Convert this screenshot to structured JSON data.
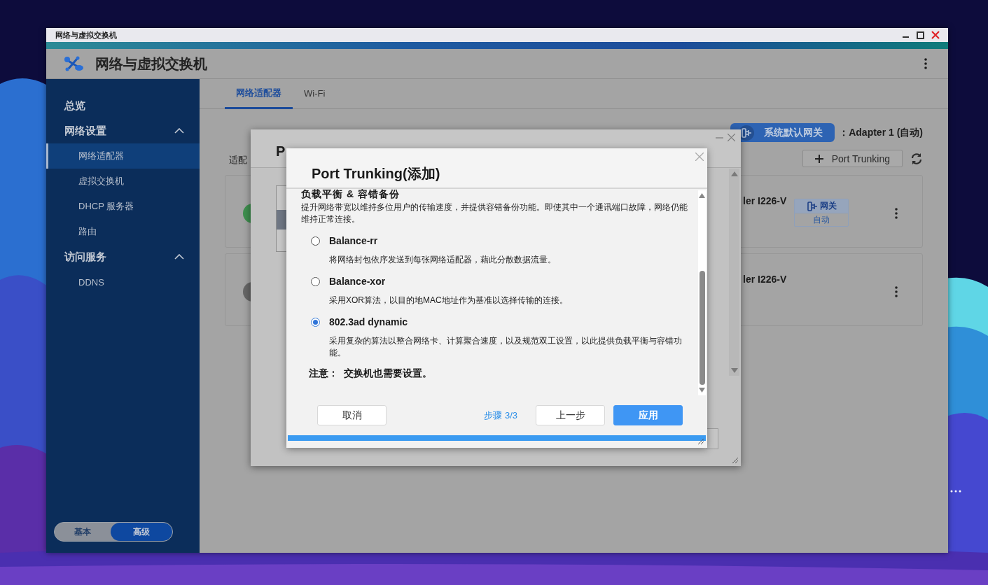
{
  "window": {
    "title": "网络与虚拟交换机"
  },
  "app": {
    "title": "网络与虚拟交换机"
  },
  "sidebar": {
    "items": [
      {
        "label": "总览",
        "kind": "link",
        "selected": false
      },
      {
        "label": "网络设置",
        "kind": "group",
        "expanded": true,
        "children": [
          {
            "label": "网络适配器",
            "selected": true
          },
          {
            "label": "虚拟交换机",
            "selected": false
          },
          {
            "label": "DHCP 服务器",
            "selected": false
          },
          {
            "label": "路由",
            "selected": false
          }
        ]
      },
      {
        "label": "访问服务",
        "kind": "group",
        "expanded": true,
        "children": [
          {
            "label": "DDNS",
            "selected": false
          }
        ]
      }
    ],
    "mode": [
      {
        "label": "基本",
        "selected": false
      },
      {
        "label": "高级",
        "selected": true
      }
    ]
  },
  "tabs": [
    {
      "label": "网络适配器",
      "selected": true
    },
    {
      "label": "Wi-Fi",
      "selected": false
    }
  ],
  "gateway": {
    "label": "系统默认网关",
    "value": "：Adapter 1 (自动)"
  },
  "add_button": "Port Trunking",
  "section_title": "适配",
  "adapters": [
    {
      "name": "ler I226-V",
      "color": "#3e8f4e",
      "badge": {
        "title": "网关",
        "subtitle": "自动"
      }
    },
    {
      "name": "ler I226-V",
      "color": "#666666"
    }
  ],
  "back_dialog": {
    "title": "P"
  },
  "dialog": {
    "title": "Port Trunking(添加)",
    "heading": "负载平衡 & 容错备份",
    "description": "提升网络带宽以维持多位用户的传输速度，并提供容错备份功能。即使其中一个通讯端口故障，网络仍能维持正常连接。",
    "options": [
      {
        "label": "Balance-rr",
        "description": "将网络封包依序发送到每张网络适配器，藉此分散数据流量。",
        "selected": false
      },
      {
        "label": "Balance-xor",
        "description": "采用XOR算法，以目的地MAC地址作为基准以选择传输的连接。",
        "selected": false
      },
      {
        "label": "802.3ad dynamic",
        "description": "采用复杂的算法以整合网络卡、计算聚合速度，以及规范双工设置，以此提供负载平衡与容错功能。",
        "selected": true
      }
    ],
    "note": "注意：  交换机也需要设置。",
    "cancel": "取消",
    "step": "步骤 3/3",
    "back": "上一步",
    "apply": "应用",
    "progress": {
      "level": 1
    }
  }
}
